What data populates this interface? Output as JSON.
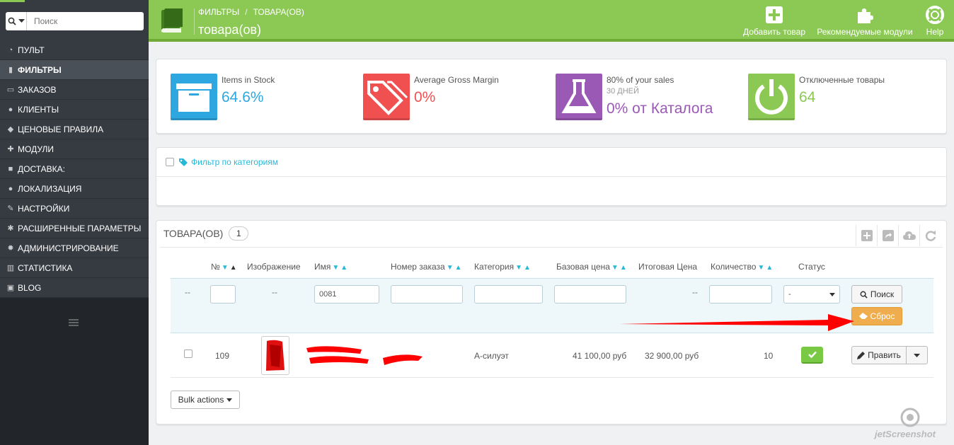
{
  "sidebar": {
    "search_placeholder": "Поиск",
    "items": [
      {
        "label": "Пульт",
        "icon": "dashboard-icon"
      },
      {
        "label": "Фильтры",
        "icon": "book-icon",
        "active": true
      },
      {
        "label": "Заказов",
        "icon": "credit-card-icon"
      },
      {
        "label": "Клиенты",
        "icon": "users-icon"
      },
      {
        "label": "Ценовые правила",
        "icon": "tags-icon"
      },
      {
        "label": "Модули",
        "icon": "puzzle-icon"
      },
      {
        "label": "Доставка:",
        "icon": "truck-icon"
      },
      {
        "label": "Локализация",
        "icon": "globe-icon"
      },
      {
        "label": "Настройки",
        "icon": "wrench-icon"
      },
      {
        "label": "Расширенные параметры",
        "icon": "cogs-icon"
      },
      {
        "label": "Администрирование",
        "icon": "gear-icon"
      },
      {
        "label": "Статистика",
        "icon": "bar-chart-icon"
      },
      {
        "label": "Blog",
        "icon": "edit-icon"
      }
    ]
  },
  "header": {
    "breadcrumb": [
      "Фильтры",
      "товара(ов)"
    ],
    "title": "товара(ов)",
    "actions": [
      {
        "label": "Добавить товар",
        "icon": "plus-square-icon"
      },
      {
        "label": "Рекомендуемые модули",
        "icon": "puzzle-icon"
      },
      {
        "label": "Help",
        "icon": "lifebuoy-icon"
      }
    ]
  },
  "kpis": [
    {
      "label": "Items in Stock",
      "value": "64.6%",
      "color": "#2ea7e0",
      "icon": "archive-icon"
    },
    {
      "label": "Average Gross Margin",
      "value": "0%",
      "color": "#f05050",
      "icon": "tags-icon"
    },
    {
      "label": "80% of your sales",
      "sub": "30 ДНЕЙ",
      "value": "0% от Каталога",
      "color": "#9b59b6",
      "icon": "flask-icon"
    },
    {
      "label": "Отключенные товары",
      "value": "64",
      "color": "#8bc954",
      "icon": "power-icon"
    }
  ],
  "category_filter": {
    "label": "Фильтр по категориям"
  },
  "products": {
    "title": "товара(ов)",
    "count": "1",
    "columns": [
      "№",
      "Изображение",
      "Имя",
      "Номер заказа",
      "Категория",
      "Базовая цена",
      "Итоговая Цена",
      "Количество",
      "Статус"
    ],
    "filters": {
      "id_dash": "--",
      "image_dash": "--",
      "name_value": "0081",
      "final_price_dash": "--",
      "status_value": "-"
    },
    "buttons": {
      "search": "Поиск",
      "reset": "Сброс"
    },
    "row": {
      "id": "109",
      "category": "А-силуэт",
      "base_price": "41 100,00 руб",
      "final_price": "32 900,00 руб",
      "quantity": "10",
      "edit_label": "Править"
    },
    "bulk_label": "Bulk actions"
  },
  "watermark": "jetScreenshot"
}
